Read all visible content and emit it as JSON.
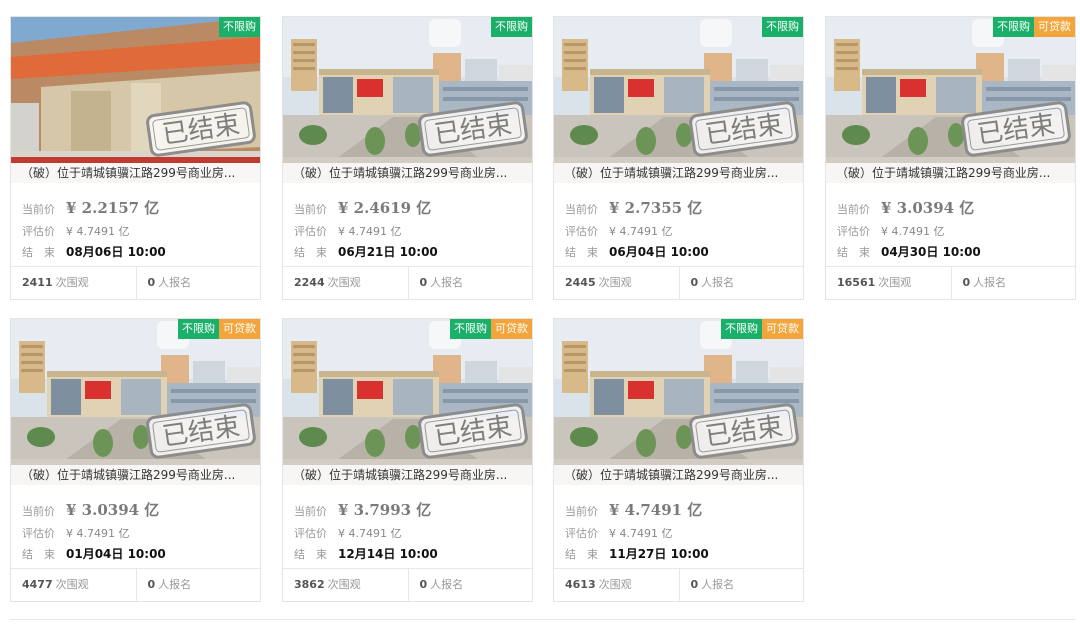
{
  "labels": {
    "current_price": "当前价",
    "estimated_price": "评估价",
    "end": "结　束",
    "views_suffix": "次围观",
    "signups_suffix": "人报名",
    "ended_stamp": "已结束"
  },
  "colors": {
    "tag_green": "#1bb06a",
    "tag_orange": "#f2a53a",
    "border": "#e4e4e4"
  },
  "cards": [
    {
      "title": "（破）位于靖城镇骥江路299号商业房...",
      "tags": [
        "不限购"
      ],
      "current_price": "¥ 2.2157 亿",
      "estimated_price": "¥ 4.7491 亿",
      "end_time": "08月06日 10:00",
      "views": "2411",
      "signups": "0",
      "photo_variant": "street"
    },
    {
      "title": "（破）位于靖城镇骥江路299号商业房...",
      "tags": [
        "不限购"
      ],
      "current_price": "¥ 2.4619 亿",
      "estimated_price": "¥ 4.7491 亿",
      "end_time": "06月21日 10:00",
      "views": "2244",
      "signups": "0",
      "photo_variant": "aerial"
    },
    {
      "title": "（破）位于靖城镇骥江路299号商业房...",
      "tags": [
        "不限购"
      ],
      "current_price": "¥ 2.7355 亿",
      "estimated_price": "¥ 4.7491 亿",
      "end_time": "06月04日 10:00",
      "views": "2445",
      "signups": "0",
      "photo_variant": "aerial"
    },
    {
      "title": "（破）位于靖城镇骥江路299号商业房...",
      "tags": [
        "不限购",
        "可贷款"
      ],
      "current_price": "¥ 3.0394 亿",
      "estimated_price": "¥ 4.7491 亿",
      "end_time": "04月30日 10:00",
      "views": "16561",
      "signups": "0",
      "photo_variant": "aerial"
    },
    {
      "title": "（破）位于靖城镇骥江路299号商业房...",
      "tags": [
        "不限购",
        "可贷款"
      ],
      "current_price": "¥ 3.0394 亿",
      "estimated_price": "¥ 4.7491 亿",
      "end_time": "01月04日 10:00",
      "views": "4477",
      "signups": "0",
      "photo_variant": "aerial"
    },
    {
      "title": "（破）位于靖城镇骥江路299号商业房...",
      "tags": [
        "不限购",
        "可贷款"
      ],
      "current_price": "¥ 3.7993 亿",
      "estimated_price": "¥ 4.7491 亿",
      "end_time": "12月14日 10:00",
      "views": "3862",
      "signups": "0",
      "photo_variant": "aerial"
    },
    {
      "title": "（破）位于靖城镇骥江路299号商业房...",
      "tags": [
        "不限购",
        "可贷款"
      ],
      "current_price": "¥ 4.7491 亿",
      "estimated_price": "¥ 4.7491 亿",
      "end_time": "11月27日 10:00",
      "views": "4613",
      "signups": "0",
      "photo_variant": "aerial"
    }
  ]
}
